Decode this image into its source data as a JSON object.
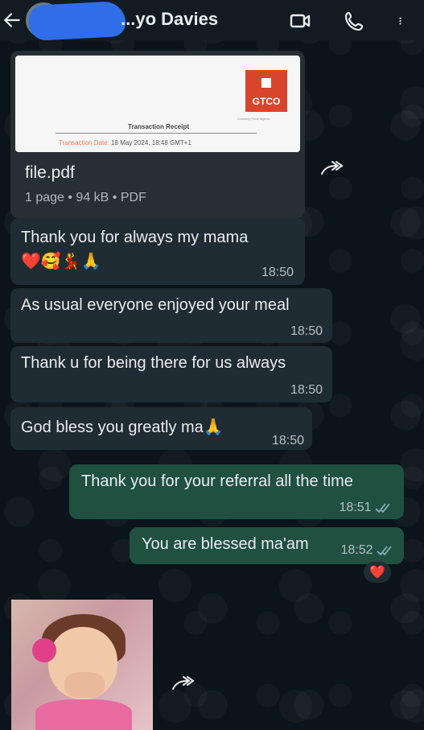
{
  "header": {
    "contact_name": "...yo Davies"
  },
  "file_message": {
    "receipt_title": "Transaction Receipt",
    "receipt_date_label": "Transaction Date:",
    "receipt_date_value": "18 May 2024, 18:48 GMT+1",
    "brand": "GTCO",
    "brand_tagline": "Guaranty Trust Nigeria",
    "file_name": "file.pdf",
    "file_meta": "1 page • 94 kB • PDF"
  },
  "messages": [
    {
      "text": "Thank you for always my mama",
      "extra": "❤️🥰💃🙏",
      "time": "18:50",
      "dir": "in"
    },
    {
      "text": "As usual everyone enjoyed your meal",
      "time": "18:50",
      "dir": "in"
    },
    {
      "text": "Thank u for being there for us always",
      "time": "18:50",
      "dir": "in"
    },
    {
      "text": "God bless you greatly ma🙏",
      "time": "18:50",
      "dir": "in"
    },
    {
      "text": "Thank you for your referral all the time",
      "time": "18:51",
      "dir": "out"
    },
    {
      "text": "You are blessed ma'am",
      "time": "18:52",
      "dir": "out"
    }
  ],
  "reaction": "❤️",
  "colors": {
    "background": "#0b141a",
    "incoming_bubble": "#202c33",
    "outgoing_bubble": "#1f5040",
    "read_ticks": "#53bdeb"
  }
}
